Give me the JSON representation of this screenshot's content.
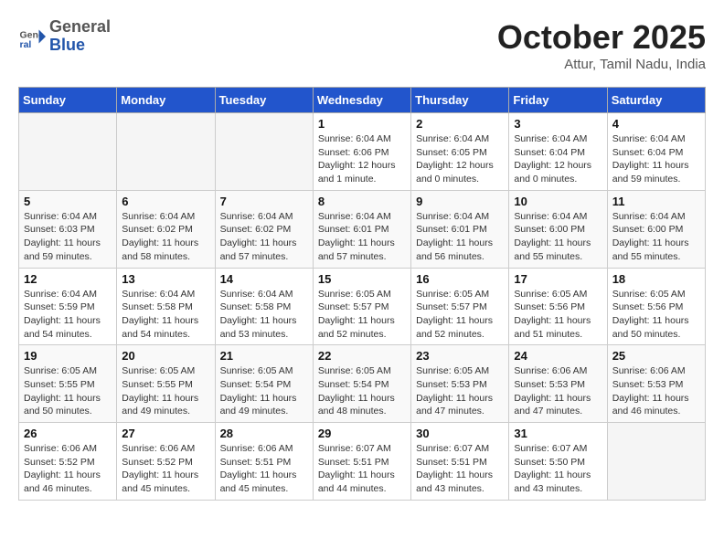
{
  "header": {
    "logo_general": "General",
    "logo_blue": "Blue",
    "month": "October 2025",
    "location": "Attur, Tamil Nadu, India"
  },
  "weekdays": [
    "Sunday",
    "Monday",
    "Tuesday",
    "Wednesday",
    "Thursday",
    "Friday",
    "Saturday"
  ],
  "weeks": [
    [
      {
        "day": "",
        "info": ""
      },
      {
        "day": "",
        "info": ""
      },
      {
        "day": "",
        "info": ""
      },
      {
        "day": "1",
        "info": "Sunrise: 6:04 AM\nSunset: 6:06 PM\nDaylight: 12 hours\nand 1 minute."
      },
      {
        "day": "2",
        "info": "Sunrise: 6:04 AM\nSunset: 6:05 PM\nDaylight: 12 hours\nand 0 minutes."
      },
      {
        "day": "3",
        "info": "Sunrise: 6:04 AM\nSunset: 6:04 PM\nDaylight: 12 hours\nand 0 minutes."
      },
      {
        "day": "4",
        "info": "Sunrise: 6:04 AM\nSunset: 6:04 PM\nDaylight: 11 hours\nand 59 minutes."
      }
    ],
    [
      {
        "day": "5",
        "info": "Sunrise: 6:04 AM\nSunset: 6:03 PM\nDaylight: 11 hours\nand 59 minutes."
      },
      {
        "day": "6",
        "info": "Sunrise: 6:04 AM\nSunset: 6:02 PM\nDaylight: 11 hours\nand 58 minutes."
      },
      {
        "day": "7",
        "info": "Sunrise: 6:04 AM\nSunset: 6:02 PM\nDaylight: 11 hours\nand 57 minutes."
      },
      {
        "day": "8",
        "info": "Sunrise: 6:04 AM\nSunset: 6:01 PM\nDaylight: 11 hours\nand 57 minutes."
      },
      {
        "day": "9",
        "info": "Sunrise: 6:04 AM\nSunset: 6:01 PM\nDaylight: 11 hours\nand 56 minutes."
      },
      {
        "day": "10",
        "info": "Sunrise: 6:04 AM\nSunset: 6:00 PM\nDaylight: 11 hours\nand 55 minutes."
      },
      {
        "day": "11",
        "info": "Sunrise: 6:04 AM\nSunset: 6:00 PM\nDaylight: 11 hours\nand 55 minutes."
      }
    ],
    [
      {
        "day": "12",
        "info": "Sunrise: 6:04 AM\nSunset: 5:59 PM\nDaylight: 11 hours\nand 54 minutes."
      },
      {
        "day": "13",
        "info": "Sunrise: 6:04 AM\nSunset: 5:58 PM\nDaylight: 11 hours\nand 54 minutes."
      },
      {
        "day": "14",
        "info": "Sunrise: 6:04 AM\nSunset: 5:58 PM\nDaylight: 11 hours\nand 53 minutes."
      },
      {
        "day": "15",
        "info": "Sunrise: 6:05 AM\nSunset: 5:57 PM\nDaylight: 11 hours\nand 52 minutes."
      },
      {
        "day": "16",
        "info": "Sunrise: 6:05 AM\nSunset: 5:57 PM\nDaylight: 11 hours\nand 52 minutes."
      },
      {
        "day": "17",
        "info": "Sunrise: 6:05 AM\nSunset: 5:56 PM\nDaylight: 11 hours\nand 51 minutes."
      },
      {
        "day": "18",
        "info": "Sunrise: 6:05 AM\nSunset: 5:56 PM\nDaylight: 11 hours\nand 50 minutes."
      }
    ],
    [
      {
        "day": "19",
        "info": "Sunrise: 6:05 AM\nSunset: 5:55 PM\nDaylight: 11 hours\nand 50 minutes."
      },
      {
        "day": "20",
        "info": "Sunrise: 6:05 AM\nSunset: 5:55 PM\nDaylight: 11 hours\nand 49 minutes."
      },
      {
        "day": "21",
        "info": "Sunrise: 6:05 AM\nSunset: 5:54 PM\nDaylight: 11 hours\nand 49 minutes."
      },
      {
        "day": "22",
        "info": "Sunrise: 6:05 AM\nSunset: 5:54 PM\nDaylight: 11 hours\nand 48 minutes."
      },
      {
        "day": "23",
        "info": "Sunrise: 6:05 AM\nSunset: 5:53 PM\nDaylight: 11 hours\nand 47 minutes."
      },
      {
        "day": "24",
        "info": "Sunrise: 6:06 AM\nSunset: 5:53 PM\nDaylight: 11 hours\nand 47 minutes."
      },
      {
        "day": "25",
        "info": "Sunrise: 6:06 AM\nSunset: 5:53 PM\nDaylight: 11 hours\nand 46 minutes."
      }
    ],
    [
      {
        "day": "26",
        "info": "Sunrise: 6:06 AM\nSunset: 5:52 PM\nDaylight: 11 hours\nand 46 minutes."
      },
      {
        "day": "27",
        "info": "Sunrise: 6:06 AM\nSunset: 5:52 PM\nDaylight: 11 hours\nand 45 minutes."
      },
      {
        "day": "28",
        "info": "Sunrise: 6:06 AM\nSunset: 5:51 PM\nDaylight: 11 hours\nand 45 minutes."
      },
      {
        "day": "29",
        "info": "Sunrise: 6:07 AM\nSunset: 5:51 PM\nDaylight: 11 hours\nand 44 minutes."
      },
      {
        "day": "30",
        "info": "Sunrise: 6:07 AM\nSunset: 5:51 PM\nDaylight: 11 hours\nand 43 minutes."
      },
      {
        "day": "31",
        "info": "Sunrise: 6:07 AM\nSunset: 5:50 PM\nDaylight: 11 hours\nand 43 minutes."
      },
      {
        "day": "",
        "info": ""
      }
    ]
  ]
}
